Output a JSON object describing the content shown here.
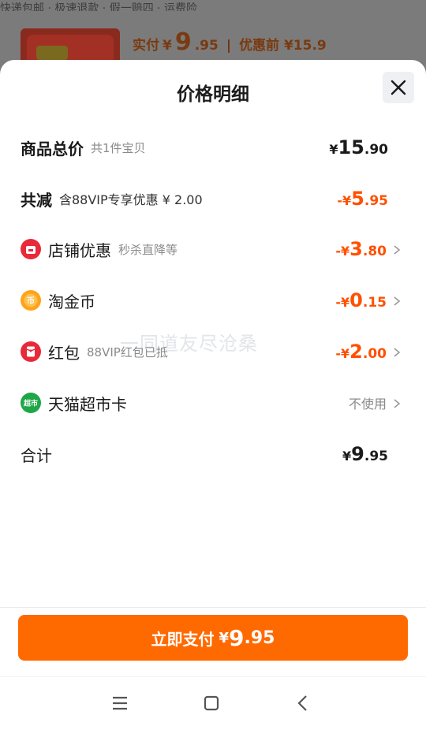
{
  "background": {
    "top_strip_text": "快递包邮 · 极速退款 · 假一赔四 · 运费险",
    "price_label": "实付",
    "currency": "¥",
    "price_int": "9",
    "price_dec": ".95",
    "before_label": "优惠前 ¥15.9"
  },
  "sheet": {
    "title": "价格明细",
    "rows": [
      {
        "label": "商品总价",
        "sub": "共1件宝贝",
        "currency": "¥",
        "int": "15",
        "dec": ".90"
      },
      {
        "label": "共减",
        "sub": "含88VIP专享优惠 ¥ 2.00",
        "currency": "-¥",
        "int": "5",
        "dec": ".95"
      },
      {
        "label": "店铺优惠",
        "sub": "秒杀直降等",
        "currency": "-¥",
        "int": "3",
        "dec": ".80"
      },
      {
        "label": "淘金币",
        "sub": "",
        "currency": "-¥",
        "int": "0",
        "dec": ".15"
      },
      {
        "label": "红包",
        "sub": "88VIP红包已抵",
        "currency": "-¥",
        "int": "2",
        "dec": ".00"
      },
      {
        "label": "天猫超市卡",
        "sub": "",
        "value": "不使用"
      },
      {
        "label": "合计",
        "sub": "",
        "currency": "¥",
        "int": "9",
        "dec": ".95"
      }
    ],
    "watermark": "一同道友尽沧桑"
  },
  "pay_button": {
    "label": "立即支付",
    "currency": "¥",
    "int": "9",
    "dec": ".95"
  },
  "colors": {
    "accent": "#ff5000",
    "button": "#ff6a00",
    "shop_icon": "#e8293a",
    "coin_icon": "#ffa31a",
    "redpacket_icon": "#e8293a",
    "supermarket_icon": "#1fa647"
  },
  "icons": {
    "close": "close-icon",
    "shop": "shop-icon",
    "coin": "coin-icon",
    "redpacket": "redpacket-icon",
    "supermarket": "supermarket-icon",
    "chevron": "chevron-right-icon",
    "nav_menu": "menu-icon",
    "nav_home": "home-icon",
    "nav_back": "back-icon"
  }
}
